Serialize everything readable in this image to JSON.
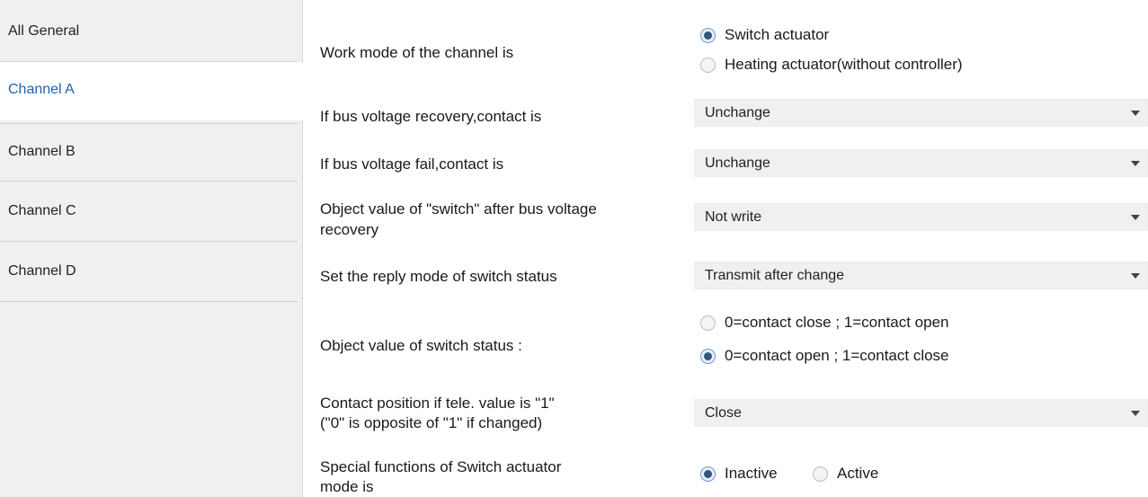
{
  "sidebar": {
    "tabs": [
      {
        "label": "All General"
      },
      {
        "label": "Channel A",
        "active": true
      },
      {
        "label": "Channel B"
      },
      {
        "label": "Channel C"
      },
      {
        "label": "Channel D"
      }
    ]
  },
  "params": {
    "work_mode": {
      "label": "Work mode of the channel is",
      "options": [
        "Switch actuator",
        "Heating actuator(without controller)"
      ],
      "selected": 0
    },
    "bus_recovery": {
      "label": "If bus voltage recovery,contact is",
      "value": "Unchange"
    },
    "bus_fail": {
      "label": "If bus voltage fail,contact is",
      "value": "Unchange"
    },
    "switch_after_recovery": {
      "label_line1": "Object value of \"switch\" after bus voltage",
      "label_line2": "recovery",
      "value": "Not write"
    },
    "reply_mode": {
      "label": "Set the reply mode of switch status",
      "value": "Transmit after change"
    },
    "switch_status_value": {
      "label": "Object value of switch status :",
      "options": [
        "0=contact close ; 1=contact open",
        "0=contact open ; 1=contact close"
      ],
      "selected": 1
    },
    "contact_position": {
      "label_line1": "Contact position if tele. value is \"1\"",
      "label_line2": " (\"0\" is opposite of \"1\" if changed)",
      "value": "Close"
    },
    "special_functions": {
      "label_line1": "Special functions of Switch actuator",
      "label_line2": "mode is",
      "options": [
        "Inactive",
        "Active"
      ],
      "selected": 0
    }
  },
  "colors": {
    "active_tab_text": "#1f62b0",
    "sidebar_bg": "#f0f0f0",
    "dropdown_bg": "#f0f0f0"
  }
}
